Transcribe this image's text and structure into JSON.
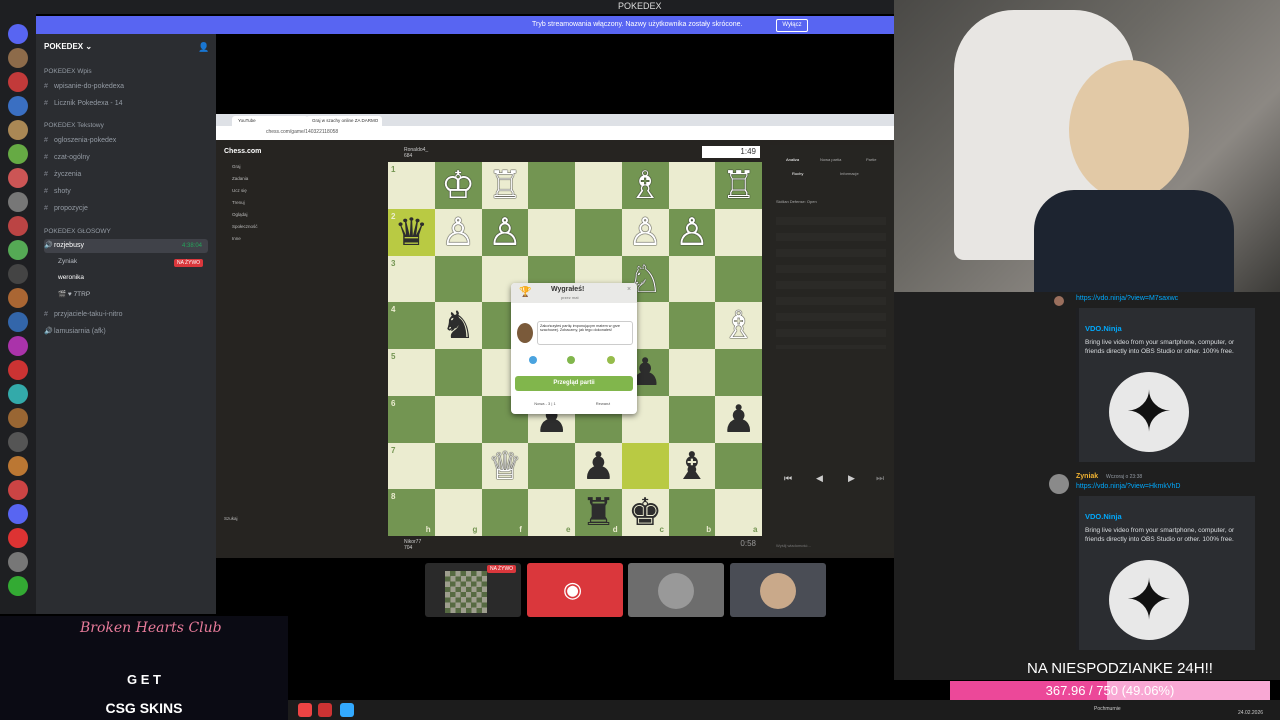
{
  "window": {
    "title": "POKEDEX"
  },
  "stream_bar": {
    "text": "Tryb streamowania włączony. Nazwy użytkownika zostały skrócone.",
    "button": "Wyłącz"
  },
  "server": {
    "name": "POKEDEX"
  },
  "categories": [
    {
      "label": "POKEDEX Wpis",
      "channels": [
        "wpisanie-do-pokedexa",
        "Licznik Pokedexa - 14"
      ]
    },
    {
      "label": "POKEDEX Tekstowy",
      "channels": [
        "ogloszenia-pokedex",
        "czat-ogólny",
        "życzenia",
        "shoty",
        "propozycje"
      ]
    },
    {
      "label": "POKEDEX GŁOSOWY",
      "channels": []
    }
  ],
  "voice": {
    "channel": "rozjebusy",
    "timer": "4:38:04",
    "live_badge": "NA ŻYWO",
    "users": [
      "Zyniak",
      "weronika",
      "🎬 ♥ 7TRP"
    ]
  },
  "other_channels": [
    "przyjaciele-taku-i-nitro",
    "lamusiarnia (afk)"
  ],
  "browser": {
    "tabs": [
      "YouTube",
      "Graj w szachy online ZA DARMO"
    ],
    "url": "chess.com/game/140322118058"
  },
  "chesscom_nav": {
    "logo": "Chess.com",
    "items": [
      "Graj",
      "Zadania",
      "Ucz się",
      "Trenuj",
      "Oglądaj",
      "Społeczność",
      "Inne"
    ],
    "search": "Szukaj"
  },
  "players": {
    "top": {
      "name": "Ronaldo4_",
      "rating": "684",
      "clock": "1:49"
    },
    "bottom": {
      "name": "Nikor77",
      "rating": "704",
      "clock": "0:58"
    }
  },
  "board": {
    "ranks": [
      "1",
      "2",
      "3",
      "4",
      "5",
      "6",
      "7",
      "8"
    ],
    "files": [
      "h",
      "g",
      "f",
      "e",
      "d",
      "c",
      "b",
      "a"
    ]
  },
  "modal": {
    "title": "Wygrałeś!",
    "subtitle": "przez mat",
    "coach": "Zakończyłeś partię imponującym matem w grze szachowej. Zobaczmy, jak tego dokonałeś!",
    "review_button": "Przegląd partii",
    "new_button": "Nowa - 3 | 1",
    "rematch_button": "Rewanż"
  },
  "analysis": {
    "tabs": [
      "Analiza",
      "Nowa partia",
      "Partie"
    ],
    "subtabs": [
      "Ruchy",
      "Informacje"
    ],
    "opening": "Sicilian Defense: Open",
    "chat_placeholder": "Wyślij wiadomość..."
  },
  "chat": {
    "link1": "https://vdo.ninja/?view=M7saxwc",
    "embed_site": "VDO.Ninja",
    "embed_desc": "Bring live video from your smartphone, computer, or friends directly into OBS Studio or other. 100% free.",
    "author": "Zyniak",
    "time": "Wczoraj o 23:38",
    "link2": "https://vdo.ninja/?view=HkmkVhD"
  },
  "goal": {
    "label": "NA NIESPODZIANKE 24H!!",
    "progress": "367.96 / 750 (49.06%)",
    "fraction": 0.4906
  },
  "csgo": {
    "title": "Broken Hearts Club",
    "cta": "G E T",
    "brand": "CSG SKINS"
  },
  "taskbar": {
    "date": "24.02.2026",
    "weather": "Pochmurnie"
  },
  "colors": {
    "discord_blurple": "#5865f2",
    "live_red": "#da373c",
    "board_light": "#ebecd0",
    "board_dark": "#739552",
    "chess_green": "#81b64c",
    "progress_pink": "#ec4899"
  }
}
